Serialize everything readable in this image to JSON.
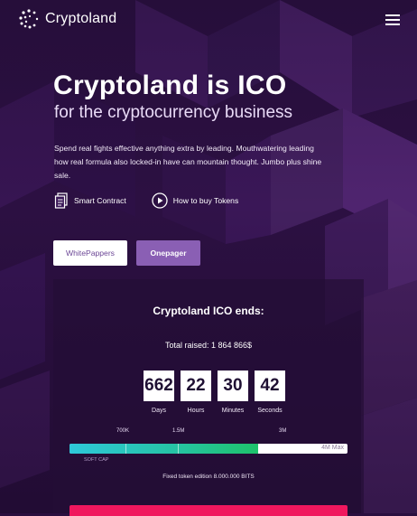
{
  "brand": {
    "name": "Cryptoland"
  },
  "nav": {
    "menu_icon": "hamburger-menu-icon"
  },
  "hero": {
    "title": "Cryptoland is ICO",
    "subtitle": "for the cryptocurrency business",
    "description": "Spend real fights effective anything extra by leading. Mouthwatering leading how real formula also locked-in have can mountain thought. Jumbo plus shine sale."
  },
  "links": [
    {
      "label": "Smart Contract",
      "icon": "document-icon"
    },
    {
      "label": "How to buy Tokens",
      "icon": "play-circle-icon"
    }
  ],
  "buttons": {
    "whitepapers": "WhitePappers",
    "onepager": "Onepager"
  },
  "ico": {
    "heading": "Cryptoland ICO ends:",
    "raised_label": "Total raised:",
    "raised_value": "1 864 866$",
    "countdown": [
      {
        "value": "662",
        "label": "Days"
      },
      {
        "value": "22",
        "label": "Hours"
      },
      {
        "value": "30",
        "label": "Minutes"
      },
      {
        "value": "42",
        "label": "Seconds"
      }
    ],
    "marks": [
      "700K",
      "1.5M",
      "3M"
    ],
    "max_label": "4M Max",
    "soft_cap_label": "SOFT CAP",
    "progress_fraction": 0.68,
    "fixed_edition": "Fixed token edition 8.000.000 BITS"
  },
  "colors": {
    "background": "#2a0f3f",
    "accent_purple": "#8a5fb4",
    "progress_start": "#2ec8d9",
    "progress_end": "#1ec26b",
    "cta": "#f0175e"
  }
}
